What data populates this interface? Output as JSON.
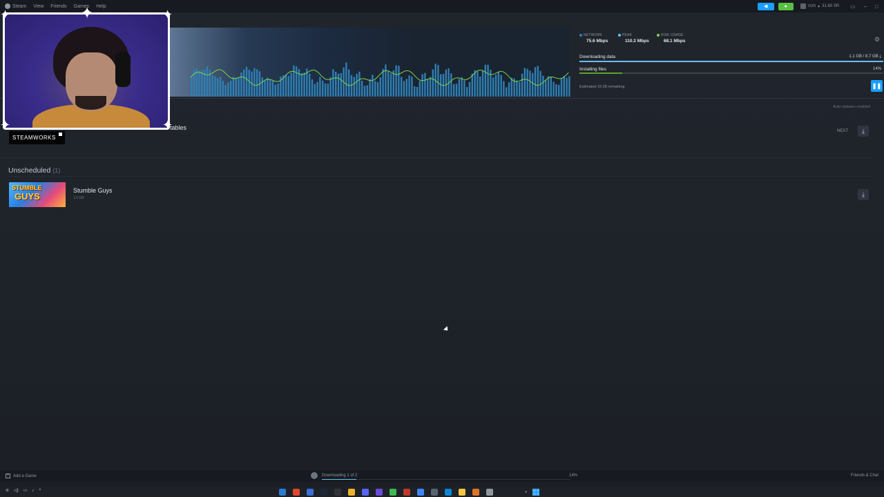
{
  "menubar": {
    "app_name": "Steam",
    "items": [
      "View",
      "Friends",
      "Games",
      "Help"
    ]
  },
  "titlebar": {
    "account_name": "rzzh",
    "wallet": "31.60 SR"
  },
  "stats": {
    "network_label": "NETWORK",
    "network_value": "75.6 Mbps",
    "peak_label": "PEAK",
    "peak_value": "110.2 Mbps",
    "disk_label": "DISK USAGE",
    "disk_value": "68.1 Mbps"
  },
  "download": {
    "downloading_label": "Downloading data",
    "downloading_value": "1.1 GB / 8.7 GB",
    "installing_label": "Installing files",
    "installing_pct": "14%",
    "downloading_progress": 1.0,
    "installing_progress": 0.14,
    "remaining": "Estimated 15:28 remaining"
  },
  "auto_updates": "Auto-updates enabled",
  "up_next": {
    "logo_text": "STEAMWORKS",
    "title_fragment": "tables",
    "next_label": "NEXT"
  },
  "unscheduled": {
    "title": "Unscheduled",
    "count": "(1)",
    "games": [
      {
        "name": "Stumble Guys",
        "size": "1.0 GB",
        "thumb_line1": "STUMBLE",
        "thumb_line2": "GUYS"
      }
    ]
  },
  "bottombar": {
    "add_game": "Add a Game",
    "downloading_status": "Downloading 1 of 2",
    "percent": "14%",
    "friends_chat": "Friends & Chat"
  },
  "colors": {
    "accent_blue": "#1a9fff",
    "accent_green": "#59bf40",
    "graph_bar": "#2f7fb3",
    "graph_line": "#7fd64a"
  }
}
